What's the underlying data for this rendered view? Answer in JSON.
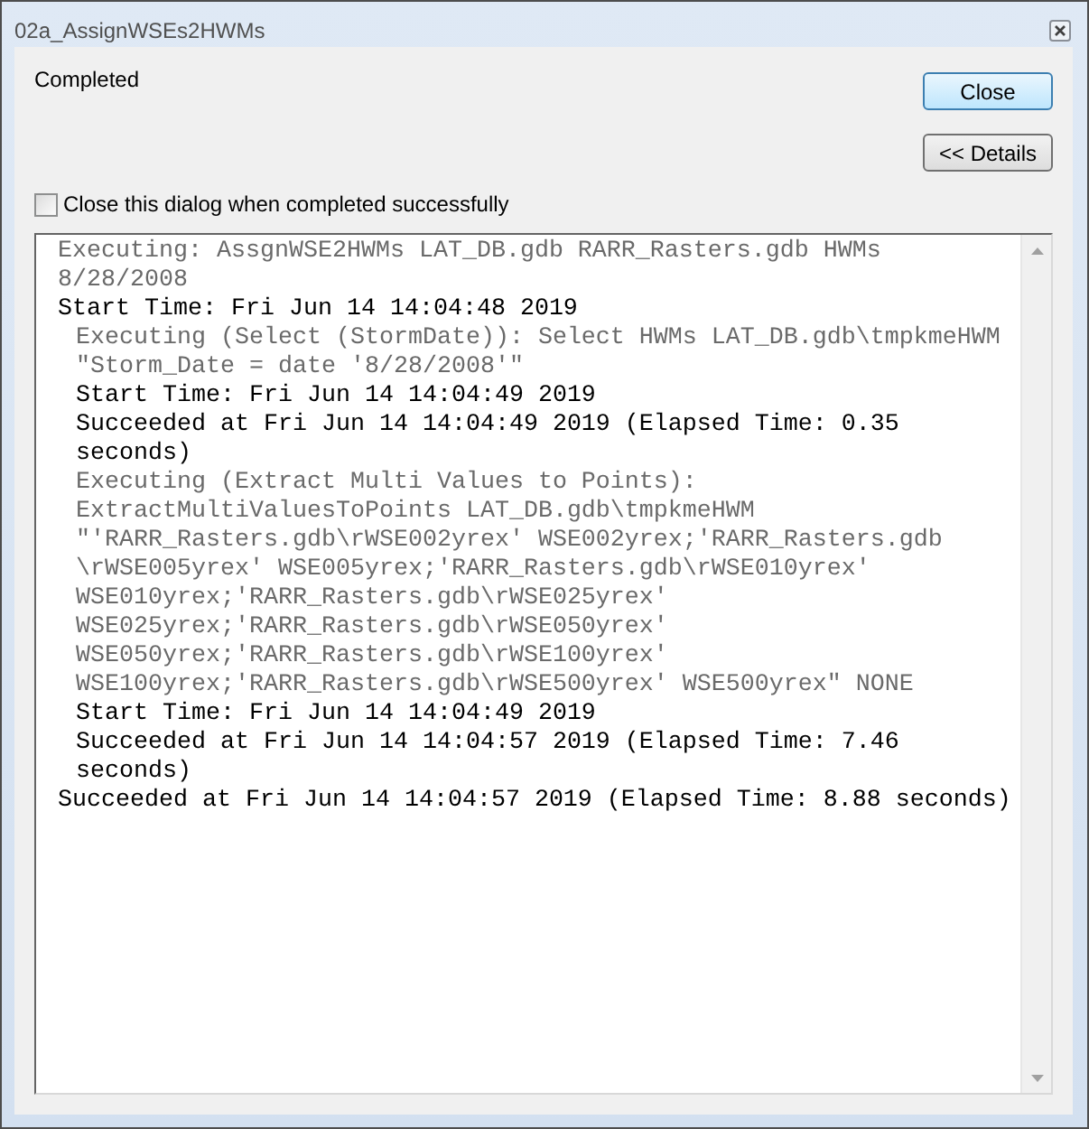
{
  "window": {
    "title": "02a_AssignWSEs2HWMs"
  },
  "status": "Completed",
  "buttons": [
    {
      "label": "Close",
      "focused": true
    },
    {
      "label": "<< Details",
      "focused": false
    }
  ],
  "close_when_done": {
    "label": "Close this dialog when completed successfully",
    "checked": false
  },
  "log": [
    {
      "kind": "info",
      "text": "Executing: AssgnWSE2HWMs LAT_DB.gdb RARR_Rasters.gdb HWMs\n8/28/2008"
    },
    {
      "kind": "status",
      "text": "Start Time: Fri Jun 14 14:04:48 2019",
      "children": [
        {
          "kind": "info",
          "text": "Executing (Select (StormDate)): Select HWMs LAT_DB.gdb\\tmpkmeHWM\n\"Storm_Date = date '8/28/2008'\""
        },
        {
          "kind": "status",
          "text": "Start Time: Fri Jun 14 14:04:49 2019"
        },
        {
          "kind": "status",
          "text": "Succeeded at Fri Jun 14 14:04:49 2019 (Elapsed Time: 0.35\nseconds)"
        },
        {
          "kind": "info",
          "text": "Executing (Extract Multi Values to Points):\nExtractMultiValuesToPoints LAT_DB.gdb\\tmpkmeHWM\n\"'RARR_Rasters.gdb\\rWSE002yrex' WSE002yrex;'RARR_Rasters.gdb\n\\rWSE005yrex' WSE005yrex;'RARR_Rasters.gdb\\rWSE010yrex'\nWSE010yrex;'RARR_Rasters.gdb\\rWSE025yrex'\nWSE025yrex;'RARR_Rasters.gdb\\rWSE050yrex'\nWSE050yrex;'RARR_Rasters.gdb\\rWSE100yrex'\nWSE100yrex;'RARR_Rasters.gdb\\rWSE500yrex' WSE500yrex\" NONE"
        },
        {
          "kind": "status",
          "text": "Start Time: Fri Jun 14 14:04:49 2019"
        },
        {
          "kind": "status",
          "text": "Succeeded at Fri Jun 14 14:04:57 2019 (Elapsed Time: 7.46\nseconds)"
        }
      ]
    },
    {
      "kind": "status",
      "text": "Succeeded at Fri Jun 14 14:04:57 2019 (Elapsed Time: 8.88 seconds)"
    }
  ]
}
